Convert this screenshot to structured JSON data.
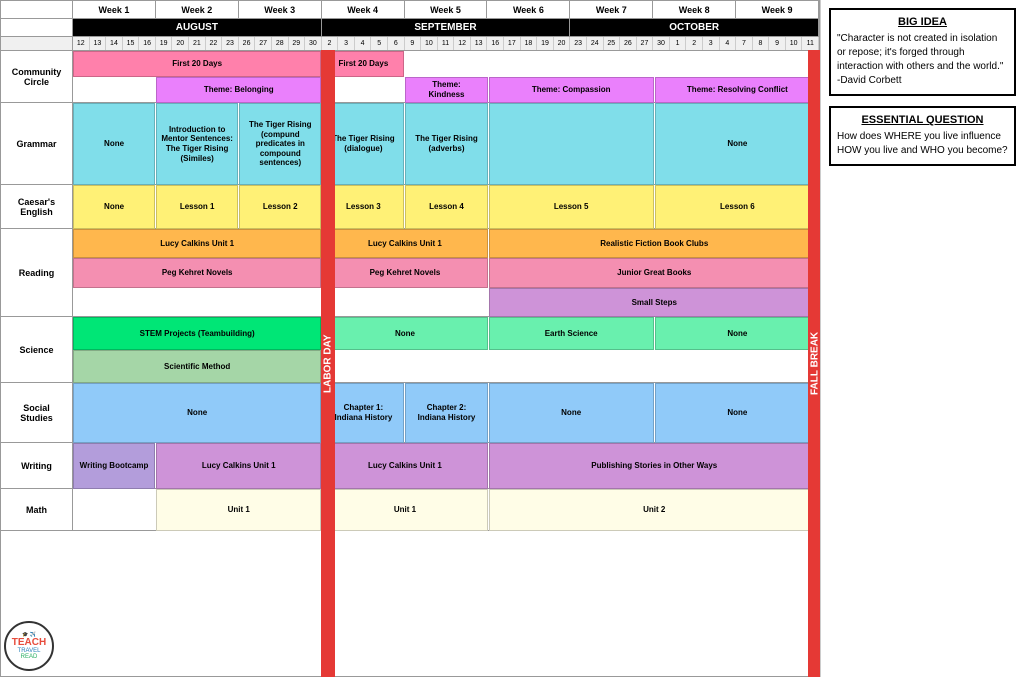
{
  "weeks": [
    "Week 1",
    "Week 2",
    "Week 3",
    "Week 4",
    "Week 5",
    "Week 6",
    "Week 7",
    "Week 8",
    "Week 9"
  ],
  "months": [
    {
      "label": "AUGUST",
      "span": 3
    },
    {
      "label": "SEPTEMBER",
      "span": 3
    },
    {
      "label": "OCTOBER",
      "span": 3
    }
  ],
  "sidebar": {
    "big_idea_title": "BIG IDEA",
    "big_idea_content": "\"Character is not created in isolation or repose; it's forged through interaction with others and the world.\" -David Corbett",
    "essential_question_title": "ESSENTIAL QUESTION",
    "essential_question_content": "How does WHERE you live influence HOW you live and WHO you become?"
  },
  "rows": [
    {
      "label": "Community Circle",
      "subrows": [
        {
          "blocks": [
            {
              "text": "First 20 Days",
              "color": "#ff9eb5",
              "colStart": 0,
              "colSpan": 3
            },
            {
              "text": "First 20 Days",
              "color": "#ff9eb5",
              "colStart": 3,
              "colSpan": 1
            }
          ]
        },
        {
          "blocks": [
            {
              "text": "Theme: Belonging",
              "color": "#e040fb",
              "colStart": 1,
              "colSpan": 2
            },
            {
              "text": "Theme: Kindness",
              "color": "#e040fb",
              "colStart": 4,
              "colSpan": 1
            },
            {
              "text": "Theme: Compassion",
              "color": "#e040fb",
              "colStart": 5,
              "colSpan": 2
            },
            {
              "text": "Theme: Resolving Conflict",
              "color": "#e040fb",
              "colStart": 7,
              "colSpan": 2
            }
          ]
        }
      ]
    },
    {
      "label": "Grammar",
      "subrows": [
        {
          "blocks": [
            {
              "text": "None",
              "color": "#80deea",
              "colStart": 0,
              "colSpan": 1
            },
            {
              "text": "Introduction to Mentor Sentences: The Tiger Rising (Similes)",
              "color": "#80deea",
              "colStart": 1,
              "colSpan": 1
            },
            {
              "text": "The Tiger Rising (compund predicates in compound sentences)",
              "color": "#80deea",
              "colStart": 2,
              "colSpan": 1
            },
            {
              "text": "The Tiger Rising (dialogue)",
              "color": "#80deea",
              "colStart": 3,
              "colSpan": 1
            },
            {
              "text": "The Tiger Rising (adverbs)",
              "color": "#80deea",
              "colStart": 4,
              "colSpan": 1
            },
            {
              "text": "",
              "color": "#80deea",
              "colStart": 5,
              "colSpan": 2
            },
            {
              "text": "None",
              "color": "#80deea",
              "colStart": 7,
              "colSpan": 2
            }
          ]
        }
      ]
    },
    {
      "label": "Caesar's English",
      "subrows": [
        {
          "blocks": [
            {
              "text": "None",
              "color": "#fff176",
              "colStart": 0,
              "colSpan": 1
            },
            {
              "text": "Lesson 1",
              "color": "#fff176",
              "colStart": 1,
              "colSpan": 1
            },
            {
              "text": "Lesson 2",
              "color": "#fff176",
              "colStart": 2,
              "colSpan": 1
            },
            {
              "text": "Lesson 3",
              "color": "#fff176",
              "colStart": 3,
              "colSpan": 1
            },
            {
              "text": "Lesson 4",
              "color": "#fff176",
              "colStart": 4,
              "colSpan": 1
            },
            {
              "text": "Lesson 5",
              "color": "#fff176",
              "colStart": 5,
              "colSpan": 2
            },
            {
              "text": "Lesson 6",
              "color": "#fff176",
              "colStart": 7,
              "colSpan": 2
            }
          ]
        }
      ]
    },
    {
      "label": "Reading",
      "subrows": [
        {
          "blocks": [
            {
              "text": "Lucy Calkins Unit 1",
              "color": "#ffb74d",
              "colStart": 0,
              "colSpan": 3
            },
            {
              "text": "Lucy Calkins Unit 1",
              "color": "#ffb74d",
              "colStart": 3,
              "colSpan": 2
            },
            {
              "text": "Realistic Fiction Book Clubs",
              "color": "#ffb74d",
              "colStart": 5,
              "colSpan": 4
            }
          ]
        },
        {
          "blocks": [
            {
              "text": "Peg Kehret Novels",
              "color": "#f48fb1",
              "colStart": 0,
              "colSpan": 3
            },
            {
              "text": "Peg Kehret Novels",
              "color": "#f48fb1",
              "colStart": 3,
              "colSpan": 2
            },
            {
              "text": "Junior Great Books",
              "color": "#f48fb1",
              "colStart": 5,
              "colSpan": 4
            }
          ]
        },
        {
          "blocks": [
            {
              "text": "Small Steps",
              "color": "#ce93d8",
              "colStart": 5,
              "colSpan": 4
            }
          ]
        }
      ]
    },
    {
      "label": "Science",
      "subrows": [
        {
          "blocks": [
            {
              "text": "STEM Projects (Teambuilding)",
              "color": "#69f0ae",
              "colStart": 0,
              "colSpan": 3
            },
            {
              "text": "None",
              "color": "#69f0ae",
              "colStart": 3,
              "colSpan": 2
            },
            {
              "text": "Earth Science",
              "color": "#69f0ae",
              "colStart": 5,
              "colSpan": 2
            },
            {
              "text": "None",
              "color": "#69f0ae",
              "colStart": 7,
              "colSpan": 2
            }
          ]
        },
        {
          "blocks": [
            {
              "text": "Scientific Method",
              "color": "#a5d6a7",
              "colStart": 0,
              "colSpan": 3
            }
          ]
        }
      ]
    },
    {
      "label": "Social Studies",
      "subrows": [
        {
          "blocks": [
            {
              "text": "None",
              "color": "#90caf9",
              "colStart": 0,
              "colSpan": 3
            },
            {
              "text": "Chapter 1: Indiana History",
              "color": "#90caf9",
              "colStart": 3,
              "colSpan": 1
            },
            {
              "text": "Chapter 2: Indiana History",
              "color": "#90caf9",
              "colStart": 4,
              "colSpan": 1
            },
            {
              "text": "None",
              "color": "#90caf9",
              "colStart": 5,
              "colSpan": 2
            },
            {
              "text": "None",
              "color": "#90caf9",
              "colStart": 7,
              "colSpan": 2
            }
          ]
        }
      ]
    },
    {
      "label": "Writing",
      "subrows": [
        {
          "blocks": [
            {
              "text": "Writing Bootcamp",
              "color": "#ce93d8",
              "colStart": 0,
              "colSpan": 1
            },
            {
              "text": "Lucy Calkins Unit 1",
              "color": "#ce93d8",
              "colStart": 1,
              "colSpan": 2
            },
            {
              "text": "Lucy Calkins Unit 1",
              "color": "#ce93d8",
              "colStart": 3,
              "colSpan": 2
            },
            {
              "text": "Publishing Stories in Other Ways",
              "color": "#ce93d8",
              "colStart": 5,
              "colSpan": 4
            }
          ]
        }
      ]
    },
    {
      "label": "Math",
      "subrows": [
        {
          "blocks": [
            {
              "text": "Unit 1",
              "color": "#fff9c4",
              "colStart": 1,
              "colSpan": 2
            },
            {
              "text": "Unit 1",
              "color": "#fff9c4",
              "colStart": 3,
              "colSpan": 2
            },
            {
              "text": "Unit 2",
              "color": "#fff9c4",
              "colStart": 5,
              "colSpan": 4
            }
          ]
        }
      ]
    }
  ],
  "labor_day_label": "LABOR DAY",
  "fall_break_label": "FALL BREAK",
  "august_days": [
    "12",
    "13",
    "14",
    "15",
    "16",
    "19",
    "20",
    "21",
    "22",
    "23",
    "26",
    "27",
    "28",
    "29",
    "30"
  ],
  "september_days": [
    "2",
    "3",
    "4",
    "5",
    "6",
    "9",
    "10",
    "11",
    "12",
    "13",
    "16",
    "17",
    "18",
    "19",
    "20",
    "23",
    "24",
    "25",
    "26",
    "27",
    "30"
  ],
  "october_days": [
    "1",
    "2",
    "3",
    "4",
    "7",
    "8",
    "9",
    "10",
    "11"
  ]
}
